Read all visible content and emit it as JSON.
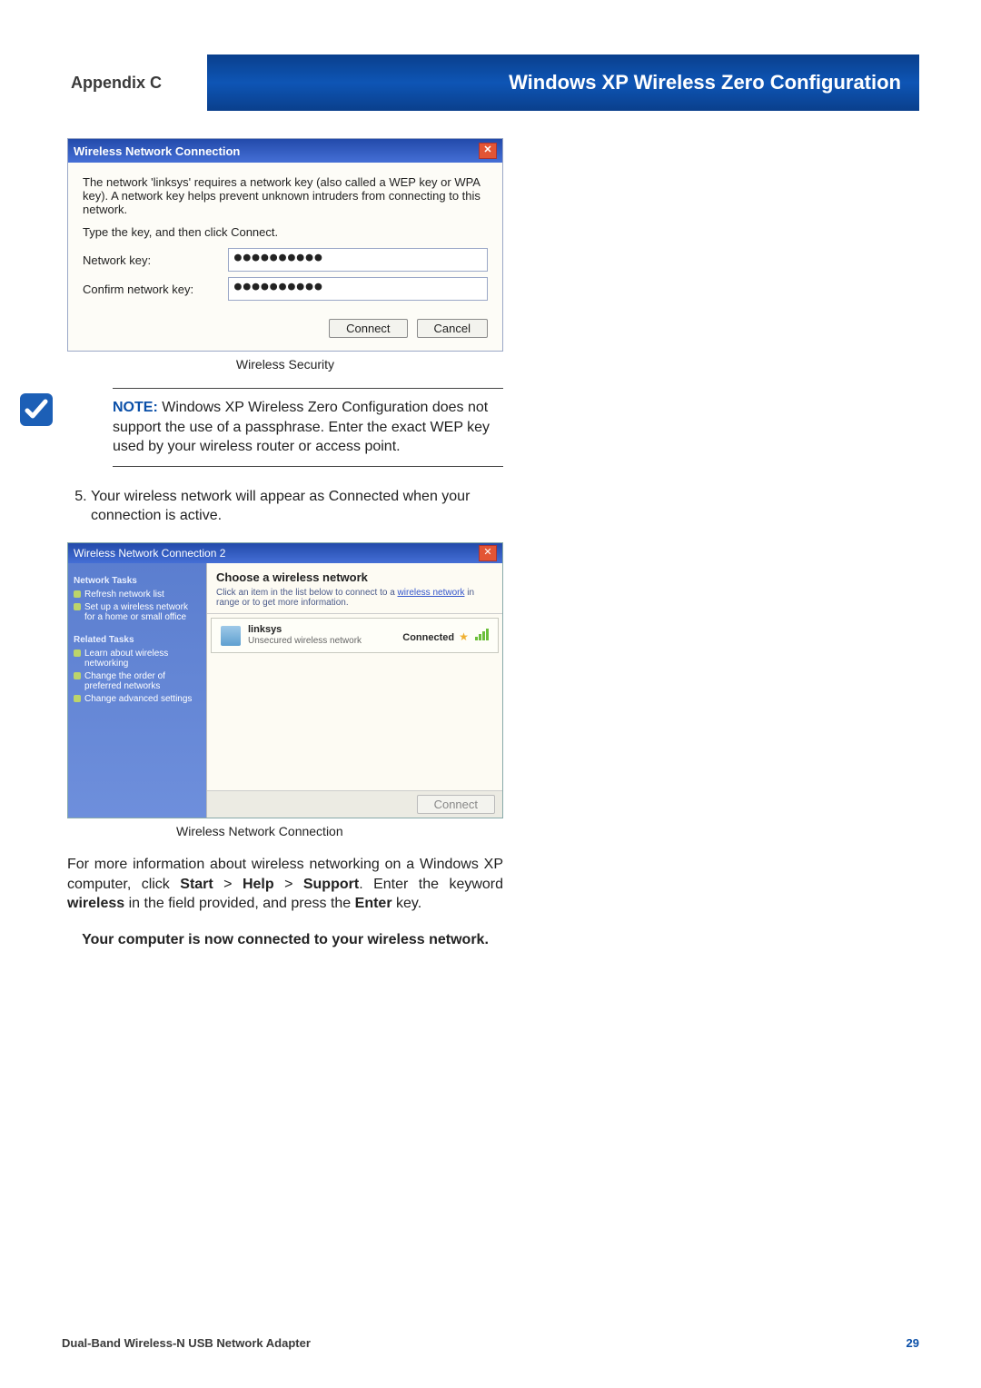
{
  "header": {
    "appendix": "Appendix C",
    "title": "Windows XP Wireless Zero Configuration"
  },
  "security_dialog": {
    "title": "Wireless Network Connection",
    "desc": "The network 'linksys' requires a network key (also called a WEP key or WPA key). A network key helps prevent unknown intruders from connecting to this network.",
    "instruction": "Type the key, and then click Connect.",
    "label_key": "Network key:",
    "label_confirm": "Confirm network key:",
    "key_value": "●●●●●●●●●●",
    "confirm_value": "●●●●●●●●●●",
    "btn_connect": "Connect",
    "btn_cancel": "Cancel",
    "caption": "Wireless Security"
  },
  "note": {
    "label": "NOTE:",
    "text": " Windows XP Wireless Zero Configuration does not support the use of a passphrase. Enter the exact WEP key used by your wireless router or access point."
  },
  "step5": {
    "number": "5.",
    "text": "Your wireless network will appear as Connected when your connection is active."
  },
  "conn_dialog": {
    "title": "Wireless Network Connection 2",
    "header": "Choose a wireless network",
    "hint_pre": "Click an item in the list below to connect to a ",
    "hint_link": "wireless network",
    "hint_post": " in range or to get more information.",
    "side": {
      "group1": "Network Tasks",
      "g1_items": [
        "Refresh network list",
        "Set up a wireless network for a home or small office"
      ],
      "group2": "Related Tasks",
      "g2_items": [
        "Learn about wireless networking",
        "Change the order of preferred networks",
        "Change advanced settings"
      ]
    },
    "network": {
      "name": "linksys",
      "sub": "Unsecured wireless network",
      "status": "Connected"
    },
    "btn_connect": "Connect",
    "caption": "Wireless Network Connection"
  },
  "info_para": {
    "t1": "For more information about wireless networking on a Windows XP computer, click ",
    "b1": "Start",
    "sep": " > ",
    "b2": "Help",
    "b3": "Support",
    "t2": ". Enter the keyword ",
    "b4": "wireless",
    "t3": " in the field provided, and press the ",
    "b5": "Enter",
    "t4": " key."
  },
  "finish": "Your computer is now connected to your wireless network.",
  "footer": {
    "product": "Dual-Band Wireless-N USB Network Adapter",
    "page": "29"
  }
}
